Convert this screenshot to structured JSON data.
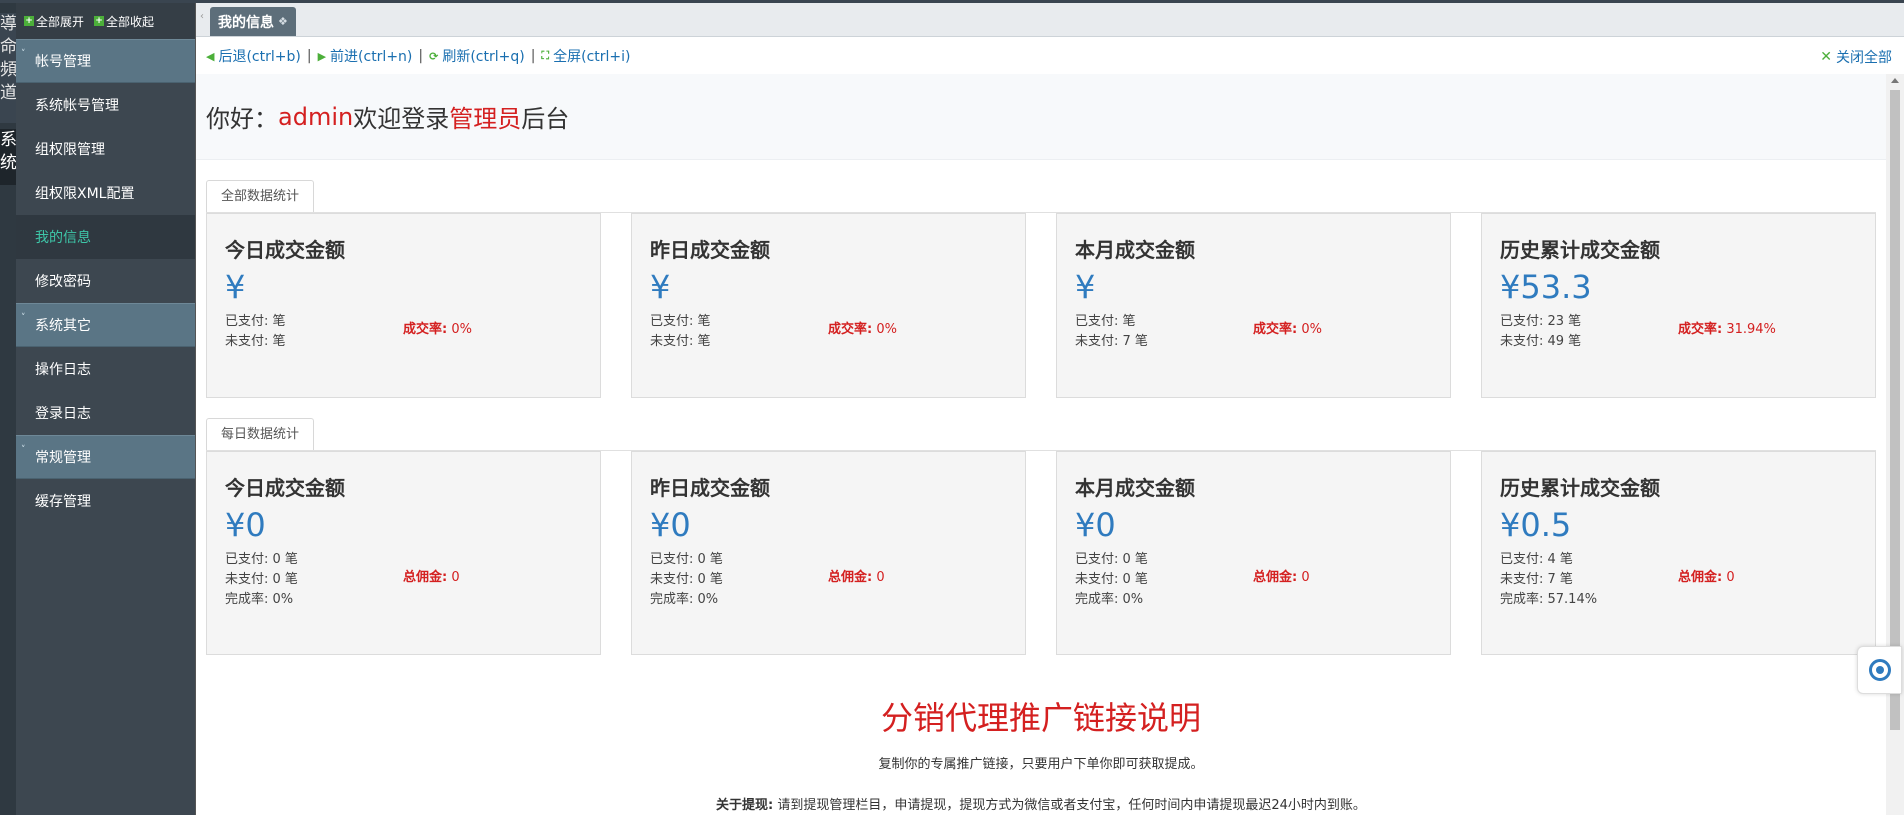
{
  "leftstrip": {
    "group1": "導命頻道",
    "group2": "系统"
  },
  "sidebar": {
    "tools": {
      "expand_all": "全部展开",
      "collapse_all": "全部收起"
    },
    "sections": [
      {
        "label": "帐号管理",
        "items": [
          "系统帐号管理",
          "组权限管理",
          "组权限XML配置",
          "我的信息",
          "修改密码"
        ]
      },
      {
        "label": "系统其它",
        "items": [
          "操作日志",
          "登录日志"
        ]
      },
      {
        "label": "常规管理",
        "items": [
          "缓存管理"
        ]
      }
    ],
    "active_item": "我的信息"
  },
  "tabs": [
    {
      "label": "我的信息"
    }
  ],
  "toolbar": {
    "back": "后退(ctrl+b)",
    "forward": "前进(ctrl+n)",
    "refresh": "刷新(ctrl+q)",
    "fullscreen": "全屏(ctrl+i)",
    "close_all": "关闭全部",
    "separator": "|"
  },
  "welcome": {
    "prefix": "你好：",
    "user": "admin",
    "middle": "欢迎登录",
    "role": "管理员",
    "suffix": "后台"
  },
  "total_stats": {
    "tab": "全部数据统计",
    "cards": [
      {
        "title": "今日成交金额",
        "amount": "¥",
        "paid": "已支付: 笔",
        "unpaid": "未支付: 笔",
        "rate_label": "成交率:",
        "rate": " 0%"
      },
      {
        "title": "昨日成交金额",
        "amount": "¥",
        "paid": "已支付: 笔",
        "unpaid": "未支付: 笔",
        "rate_label": "成交率:",
        "rate": " 0%"
      },
      {
        "title": "本月成交金额",
        "amount": "¥",
        "paid": "已支付: 笔",
        "unpaid": "未支付: 7 笔",
        "rate_label": "成交率:",
        "rate": " 0%"
      },
      {
        "title": "历史累计成交金额",
        "amount": "¥53.3",
        "paid": "已支付: 23 笔",
        "unpaid": "未支付: 49 笔",
        "rate_label": "成交率:",
        "rate": " 31.94%"
      }
    ]
  },
  "daily_stats": {
    "tab": "每日数据统计",
    "cards": [
      {
        "title": "今日成交金额",
        "amount": "¥0",
        "paid": "已支付: 0 笔",
        "unpaid": "未支付: 0 笔",
        "completion": "完成率: 0%",
        "commission_label": "总佣金:",
        "commission": " 0"
      },
      {
        "title": "昨日成交金额",
        "amount": "¥0",
        "paid": "已支付: 0 笔",
        "unpaid": "未支付: 0 笔",
        "completion": "完成率: 0%",
        "commission_label": "总佣金:",
        "commission": " 0"
      },
      {
        "title": "本月成交金额",
        "amount": "¥0",
        "paid": "已支付: 0 笔",
        "unpaid": "未支付: 0 笔",
        "completion": "完成率: 0%",
        "commission_label": "总佣金:",
        "commission": " 0"
      },
      {
        "title": "历史累计成交金额",
        "amount": "¥0.5",
        "paid": "已支付: 4 笔",
        "unpaid": "未支付: 7 笔",
        "completion": "完成率: 57.14%",
        "commission_label": "总佣金:",
        "commission": " 0"
      }
    ]
  },
  "promo": {
    "title": "分销代理推广链接说明",
    "desc": "复制你的专属推广链接，只要用户下单你即可获取提成。",
    "note_label": "关于提现:",
    "note": " 请到提现管理栏目，申请提现，提现方式为微信或者支付宝，任何时间内申请提现最迟24小时内到账。"
  },
  "colors": {
    "accent": "#d42020",
    "amount": "#2f7bbf",
    "active_menu": "#3ec6a8",
    "group_bg": "#5a7585"
  }
}
